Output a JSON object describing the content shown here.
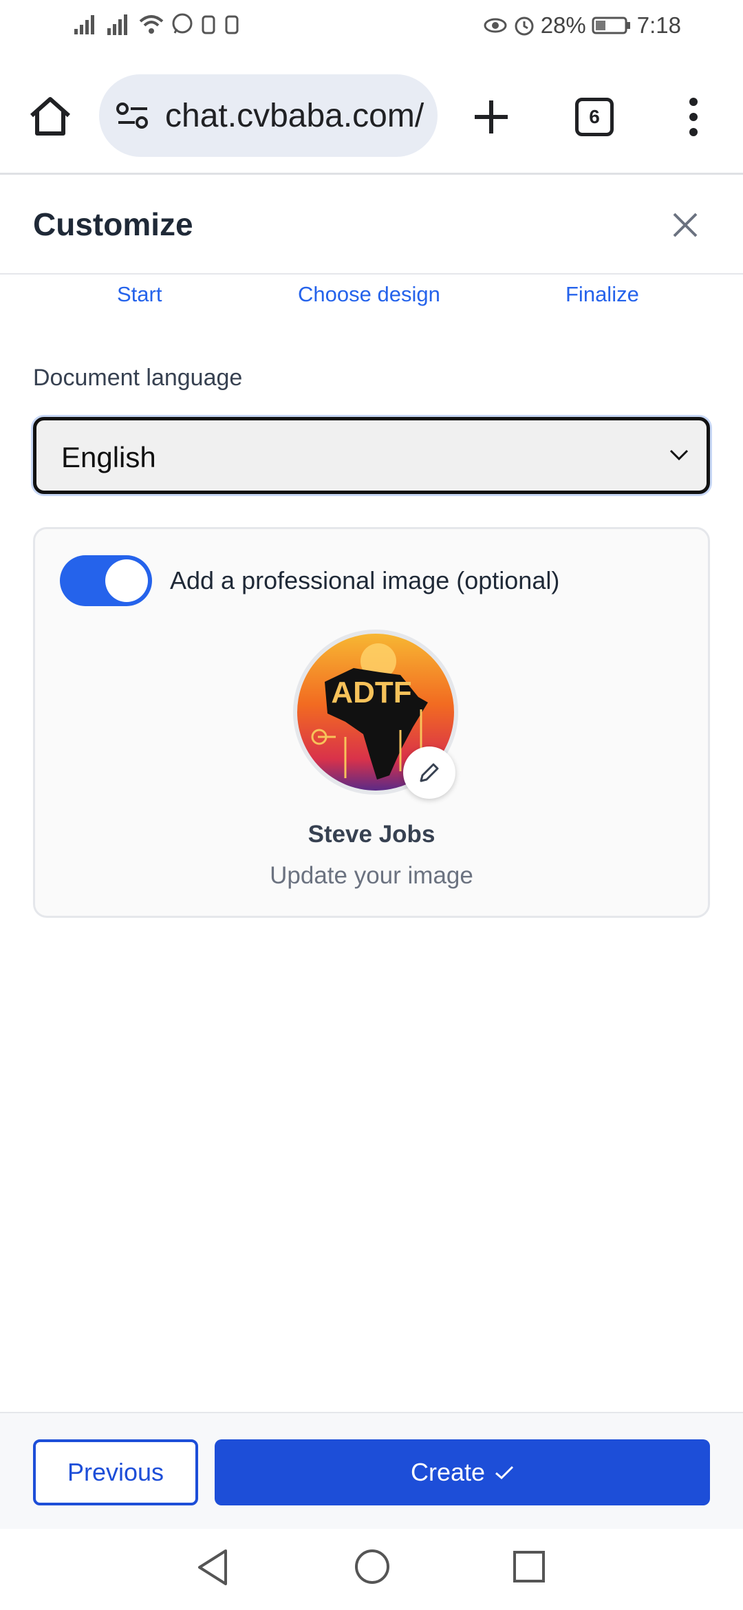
{
  "status_bar": {
    "battery": "28%",
    "time": "7:18"
  },
  "browser": {
    "url": "chat.cvbaba.com/",
    "tab_count": "6"
  },
  "modal": {
    "title": "Customize"
  },
  "steps": [
    {
      "label": "Start"
    },
    {
      "label": "Choose design"
    },
    {
      "label": "Finalize"
    }
  ],
  "language": {
    "label": "Document language",
    "selected": "English"
  },
  "image_section": {
    "toggle_on": true,
    "toggle_label": "Add a professional image (optional)",
    "avatar_text": "ADTF",
    "name": "Steve Jobs",
    "update_label": "Update your image"
  },
  "footer": {
    "previous_label": "Previous",
    "create_label": "Create"
  },
  "colors": {
    "accent": "#1d4ed8",
    "link": "#2563eb",
    "text": "#1f2937"
  }
}
